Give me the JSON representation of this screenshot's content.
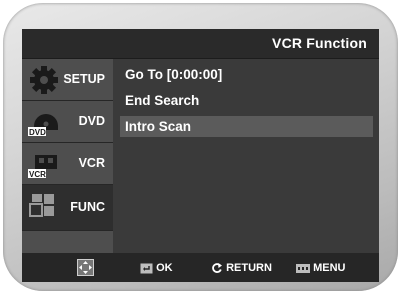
{
  "header": {
    "title": "VCR Function"
  },
  "sidebar": {
    "items": [
      {
        "label": "SETUP",
        "icon": "gear-icon"
      },
      {
        "label": "DVD",
        "icon": "dvd-disc-icon",
        "badge": "DVD"
      },
      {
        "label": "VCR",
        "icon": "vcr-cassette-icon",
        "badge": "VCR"
      },
      {
        "label": "FUNC",
        "icon": "function-blocks-icon",
        "active": true
      }
    ]
  },
  "menu": {
    "items": [
      {
        "label": "Go To [0:00:00]"
      },
      {
        "label": "End Search"
      },
      {
        "label": "Intro Scan",
        "highlighted": true
      }
    ]
  },
  "footer": {
    "nav_icon": "dpad-arrows-icon",
    "ok_label": "OK",
    "return_label": "RETURN",
    "menu_label": "MENU"
  },
  "colors": {
    "background": "#3a3a3a",
    "titlebar": "#2a2a2a",
    "sidebar": "#4e4e4e",
    "highlight": "#5b5b5b",
    "text": "#ffffff"
  }
}
